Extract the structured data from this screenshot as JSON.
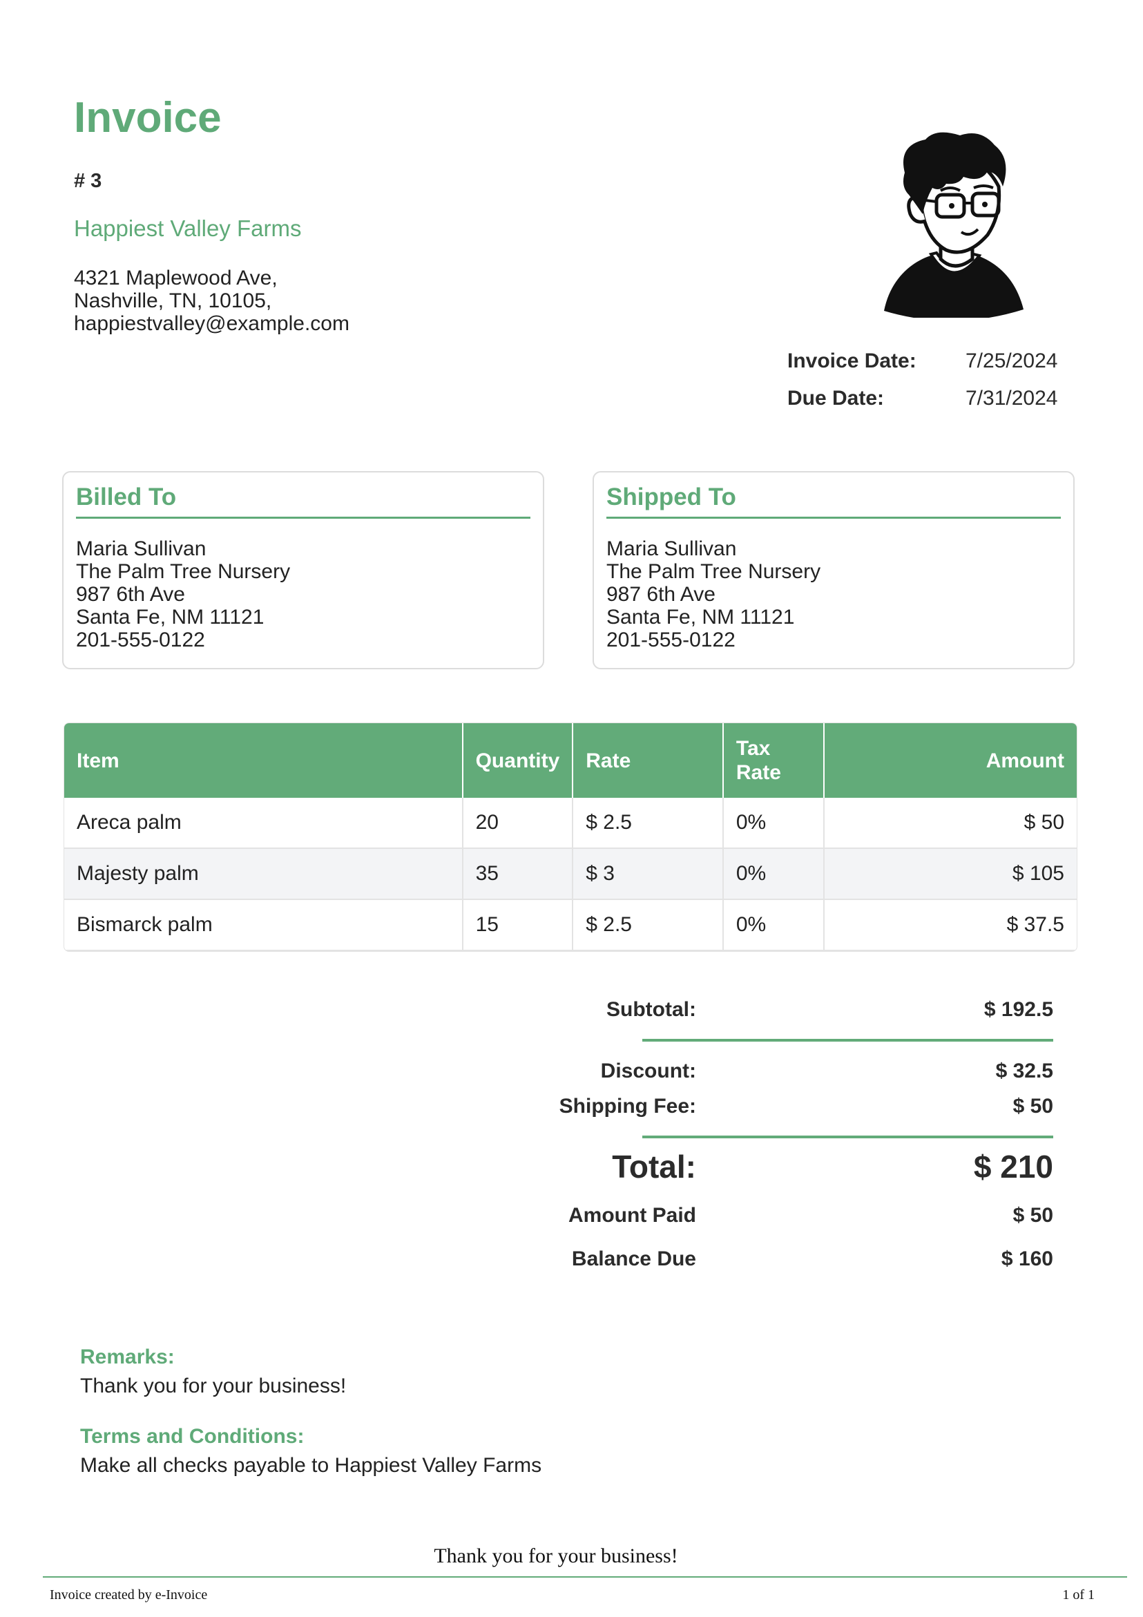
{
  "header": {
    "title": "Invoice",
    "number": "# 3",
    "company": "Happiest Valley Farms",
    "address_lines": [
      "4321 Maplewood Ave,",
      "Nashville, TN, 10105,",
      "happiestvalley@example.com"
    ]
  },
  "dates": {
    "invoice_date_label": "Invoice Date:",
    "invoice_date": "7/25/2024",
    "due_date_label": "Due Date:",
    "due_date": "7/31/2024"
  },
  "billed_to": {
    "title": "Billed To",
    "lines": [
      "Maria Sullivan",
      "The Palm Tree Nursery",
      "987 6th Ave",
      "Santa Fe, NM 11121",
      "201-555-0122"
    ]
  },
  "shipped_to": {
    "title": "Shipped To",
    "lines": [
      "Maria Sullivan",
      "The Palm Tree Nursery",
      "987 6th Ave",
      "Santa Fe, NM 11121",
      "201-555-0122"
    ]
  },
  "items_table": {
    "headers": [
      "Item",
      "Quantity",
      "Rate",
      "Tax Rate",
      "Amount"
    ],
    "rows": [
      [
        "Areca palm",
        "20",
        "$ 2.5",
        "0%",
        "$ 50"
      ],
      [
        "Majesty palm",
        "35",
        "$ 3",
        "0%",
        "$ 105"
      ],
      [
        "Bismarck palm",
        "15",
        "$ 2.5",
        "0%",
        "$ 37.5"
      ]
    ]
  },
  "totals": {
    "subtotal_label": "Subtotal:",
    "subtotal": "$ 192.5",
    "discount_label": "Discount:",
    "discount": "$ 32.5",
    "shipping_label": "Shipping Fee:",
    "shipping": "$ 50",
    "total_label": "Total:",
    "total": "$ 210",
    "paid_label": "Amount Paid",
    "paid": "$ 50",
    "balance_label": "Balance Due",
    "balance": "$ 160"
  },
  "remarks": {
    "label": "Remarks:",
    "text": "Thank you for your business!"
  },
  "terms": {
    "label": "Terms and Conditions:",
    "text": "Make all checks payable to Happiest Valley Farms"
  },
  "footer": {
    "thanks": "Thank you for your business!",
    "created_by": "Invoice created by e-Invoice",
    "page": "1 of 1"
  },
  "colors": {
    "accent": "#5faa78",
    "table_header": "#62ab79",
    "alt_row": "#f3f4f6"
  },
  "icons": {
    "avatar": "avatar-icon"
  }
}
